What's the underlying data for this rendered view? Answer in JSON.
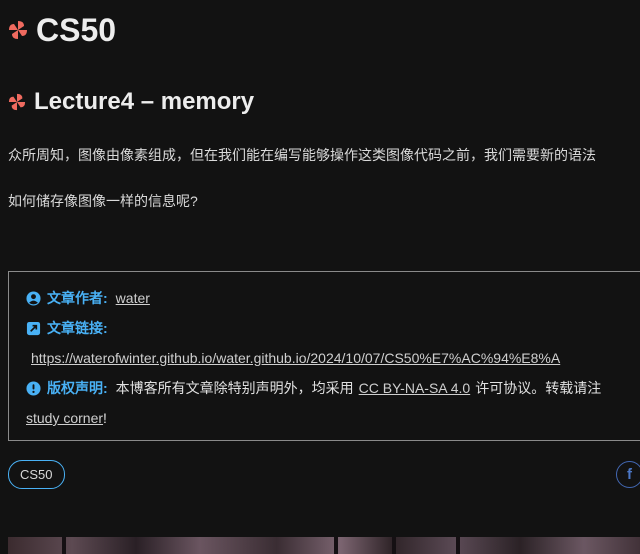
{
  "site_title": "CS50",
  "post_title": "Lecture4 – memory",
  "paragraphs": [
    "众所周知，图像由像素组成，但在我们能在编写能够操作这类图像代码之前，我们需要新的语法",
    "如何储存像图像一样的信息呢?"
  ],
  "copyright": {
    "author_label": "文章作者:",
    "author_name": "water",
    "link_label": "文章链接:",
    "link_url": "https://waterofwinter.github.io/water.github.io/2024/10/07/CS50%E7%AC%94%E8%A",
    "notice_label": "版权声明:",
    "notice_text_prefix": "本博客所有文章除特别声明外，均采用",
    "license": "CC BY-NA-SA 4.0",
    "notice_text_suffix": "许可协议。转载请注",
    "blog_name": "study corner",
    "blog_suffix": "!"
  },
  "tag": "CS50",
  "share_facebook_glyph": "f",
  "icons": {
    "heading": "pinwheel-icon",
    "author": "user-circle-icon",
    "link": "external-link-icon",
    "notice": "info-circle-icon",
    "share": "facebook-icon"
  },
  "colors": {
    "background": "#121212",
    "accent": "#49b1f5",
    "pinwheel": "#ef6a5f",
    "facebook": "#4267b2"
  }
}
